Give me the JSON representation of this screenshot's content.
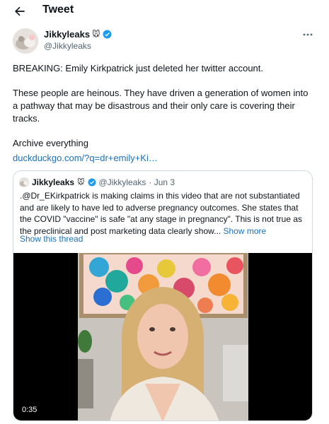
{
  "header": {
    "title": "Tweet",
    "back_icon": "back-arrow-icon"
  },
  "author": {
    "display_name": "Jikkyleaks",
    "name_emoji": "🐭",
    "handle": "@Jikkyleaks",
    "verified_color": "#1d9bf0"
  },
  "tweet": {
    "line1": "BREAKING: Emily Kirkpatrick just deleted her twitter account.",
    "line2": "These people are heinous. They have driven a generation of women into a pathway that may be disastrous and their only care is covering their tracks.",
    "line3": "Archive everything",
    "link": "duckduckgo.com/?q=dr+emily+Ki…"
  },
  "quoted": {
    "display_name": "Jikkyleaks",
    "name_emoji": "🐭",
    "handle": "@Jikkyleaks",
    "date": "· Jun 3",
    "text": ".@Dr_EKirkpatrick is making claims in this video that are not substantiated and are likely to have led to adverse pregnancy outcomes. She states that the COVID \"vaccine\" is safe \"at any stage in pregnancy\". This is not true as the preclinical and post marketing data clearly show...",
    "show_more": "Show more",
    "show_thread": "Show this thread",
    "video_duration": "0:35"
  },
  "colors": {
    "link": "#1d70b8",
    "text": "#0f1419",
    "muted": "#536471",
    "border": "#cfd9de"
  }
}
